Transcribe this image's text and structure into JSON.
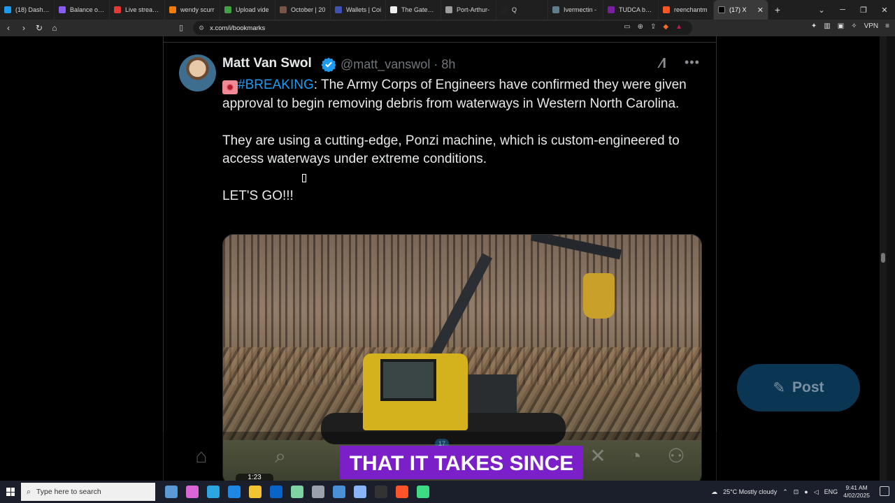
{
  "browser": {
    "tabs": [
      {
        "title": "(18) Dashbo",
        "color": "#1d9bf0"
      },
      {
        "title": "Balance over",
        "color": "#8a5cf6"
      },
      {
        "title": "Live streamin",
        "color": "#e53935"
      },
      {
        "title": "wendy scurr",
        "color": "#f57c00"
      },
      {
        "title": "Upload vide",
        "color": "#43a047"
      },
      {
        "title": "October | 20",
        "color": "#795548"
      },
      {
        "title": "Wallets | Coi",
        "color": "#3f51b5"
      },
      {
        "title": "The Gateway",
        "color": "#eeeeee"
      },
      {
        "title": "Port-Arthur-",
        "color": "#9e9e9e"
      },
      {
        "title": "Q",
        "color": "#222222"
      },
      {
        "title": "Ivermectin -",
        "color": "#607d8b"
      },
      {
        "title": "TUDCA bene",
        "color": "#7b1fa2"
      },
      {
        "title": "reenchantm",
        "color": "#ff5722"
      }
    ],
    "active_tab": {
      "title": "(17) X",
      "close": "✕"
    },
    "new_tab": "+",
    "url": "x.com/i/bookmarks",
    "vpn_label": "VPN"
  },
  "tweet": {
    "author_name": "Matt Van Swol",
    "handle_time": "@matt_vanswol · 8h",
    "hashtag": "#BREAKING",
    "para1_rest": ": The Army Corps of Engineers have confirmed they were given approval to begin removing debris from waterways in Western North Carolina.",
    "para2": "They are using a cutting-edge, Ponzi machine, which is custom-engineered to access waterways under extreme conditions.",
    "para3": "LET'S GO!!!",
    "video_caption": "THAT IT TAKES SINCE",
    "video_time": "1:23"
  },
  "nav": {
    "badge_count": "17",
    "post_label": "Post"
  },
  "taskbar": {
    "search_placeholder": "Type here to search",
    "weather": "25°C  Mostly cloudy",
    "lang": "ENG",
    "time": "9:41 AM",
    "date": "4/02/2025"
  }
}
